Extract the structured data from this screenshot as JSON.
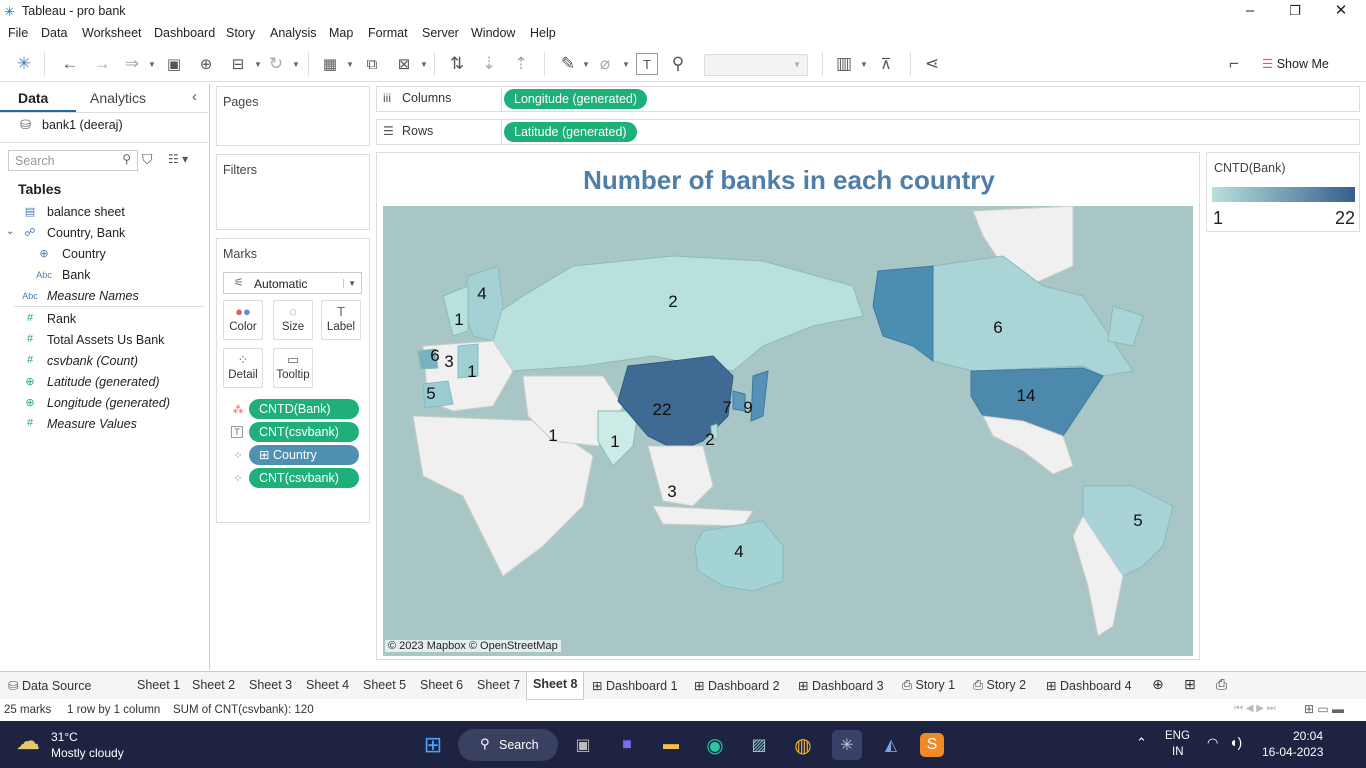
{
  "window": {
    "title": "Tableau - pro bank"
  },
  "menu": [
    "File",
    "Data",
    "Worksheet",
    "Dashboard",
    "Story",
    "Analysis",
    "Map",
    "Format",
    "Server",
    "Window",
    "Help"
  ],
  "toolbar": {
    "show_me": "Show Me"
  },
  "left": {
    "tab_data": "Data",
    "tab_analytics": "Analytics",
    "datasource": "bank1 (deeraj)",
    "search_placeholder": "Search",
    "tables_header": "Tables",
    "fields": [
      {
        "label": "balance sheet",
        "icon": "table-icon"
      },
      {
        "label": "Country, Bank",
        "icon": "hierarchy-icon"
      },
      {
        "label": "Country",
        "icon": "globe-icon"
      },
      {
        "label": "Bank",
        "icon": "abc-icon"
      },
      {
        "label": "Measure Names",
        "icon": "abc-icon"
      },
      {
        "label": "Rank",
        "icon": "hash-icon"
      },
      {
        "label": "Total Assets Us Bank",
        "icon": "hash-icon"
      },
      {
        "label": "csvbank (Count)",
        "icon": "hash-icon"
      },
      {
        "label": "Latitude (generated)",
        "icon": "globe-icon"
      },
      {
        "label": "Longitude (generated)",
        "icon": "globe-icon"
      },
      {
        "label": "Measure Values",
        "icon": "hash-icon"
      }
    ]
  },
  "cards": {
    "pages": "Pages",
    "filters": "Filters",
    "marks": "Marks",
    "mark_type": "Automatic",
    "buttons": {
      "color": "Color",
      "size": "Size",
      "label": "Label",
      "detail": "Detail",
      "tooltip": "Tooltip"
    },
    "mark_pills": [
      "CNTD(Bank)",
      "CNT(csvbank)",
      "Country",
      "CNT(csvbank)"
    ]
  },
  "shelves": {
    "columns_label": "Columns",
    "columns_pill": "Longitude (generated)",
    "rows_label": "Rows",
    "rows_pill": "Latitude (generated)"
  },
  "viz": {
    "title": "Number of banks in each country",
    "attribution": "© 2023 Mapbox © OpenStreetMap"
  },
  "legend": {
    "title": "CNTD(Bank)",
    "min": "1",
    "max": "22",
    "color_low": "#b9e0dc",
    "color_high": "#355f8c"
  },
  "map_labels": [
    {
      "value": "2",
      "region": "Russia"
    },
    {
      "value": "4",
      "region": "Nordic"
    },
    {
      "value": "1",
      "region": "Norway"
    },
    {
      "value": "6",
      "region": "UK"
    },
    {
      "value": "3",
      "region": "Netherlands"
    },
    {
      "value": "1",
      "region": "Germany"
    },
    {
      "value": "5",
      "region": "Spain"
    },
    {
      "value": "1",
      "region": "Middle East"
    },
    {
      "value": "1",
      "region": "India"
    },
    {
      "value": "22",
      "region": "China"
    },
    {
      "value": "2",
      "region": "Taiwan"
    },
    {
      "value": "7",
      "region": "Korea"
    },
    {
      "value": "9",
      "region": "Japan"
    },
    {
      "value": "3",
      "region": "Singapore"
    },
    {
      "value": "4",
      "region": "Australia"
    },
    {
      "value": "6",
      "region": "Canada"
    },
    {
      "value": "14",
      "region": "USA"
    },
    {
      "value": "5",
      "region": "Brazil"
    }
  ],
  "tabs": [
    "Data Source",
    "Sheet 1",
    "Sheet 2",
    "Sheet 3",
    "Sheet 4",
    "Sheet 5",
    "Sheet 6",
    "Sheet 7",
    "Sheet 8",
    "Dashboard 1",
    "Dashboard 2",
    "Dashboard 3",
    "Story 1",
    "Story 2",
    "Dashboard 4"
  ],
  "status": {
    "marks": "25 marks",
    "rows_cols": "1 row by 1 column",
    "sum": "SUM of CNT(csvbank): 120"
  },
  "taskbar": {
    "weather_temp": "31°C",
    "weather_desc": "Mostly cloudy",
    "search": "Search",
    "lang1": "ENG",
    "lang2": "IN",
    "time": "20:04",
    "date": "16-04-2023"
  }
}
